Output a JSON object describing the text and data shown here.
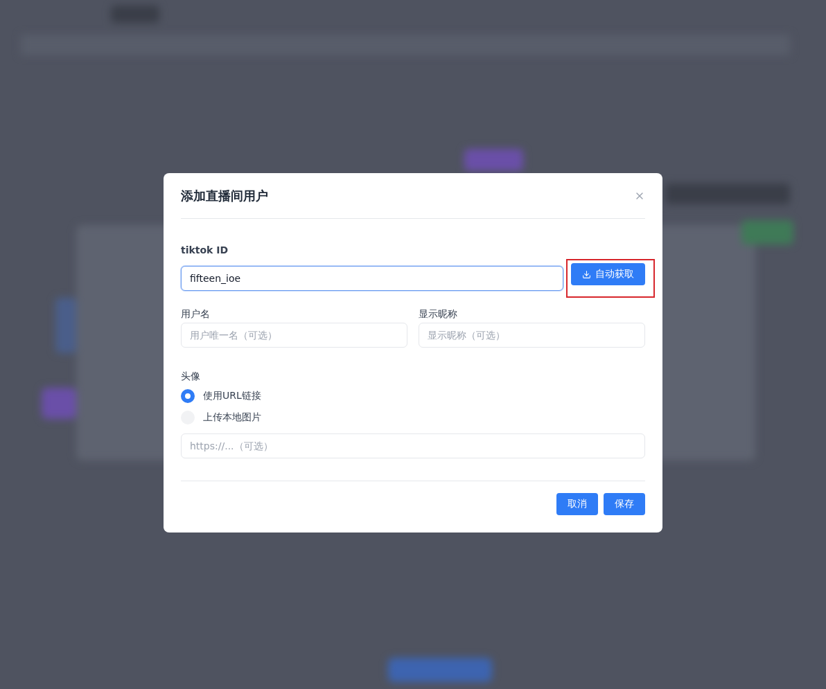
{
  "dialog": {
    "title": "添加直播间用户",
    "tiktok_id": {
      "label": "tiktok ID",
      "value": "fifteen_ioe",
      "focused": true
    },
    "fetch_button": {
      "label": "自动获取",
      "highlighted": true
    },
    "username": {
      "label": "用户名",
      "placeholder": "用户唯一名（可选）"
    },
    "nickname": {
      "label": "显示昵称",
      "placeholder": "显示昵称（可选）"
    },
    "avatar": {
      "label": "头像",
      "options": [
        {
          "label": "使用URL链接",
          "selected": true
        },
        {
          "label": "上传本地图片",
          "selected": false
        }
      ],
      "url_placeholder": "https://...（可选）"
    },
    "buttons": [
      {
        "label": "取消"
      },
      {
        "label": "保存"
      }
    ]
  }
}
